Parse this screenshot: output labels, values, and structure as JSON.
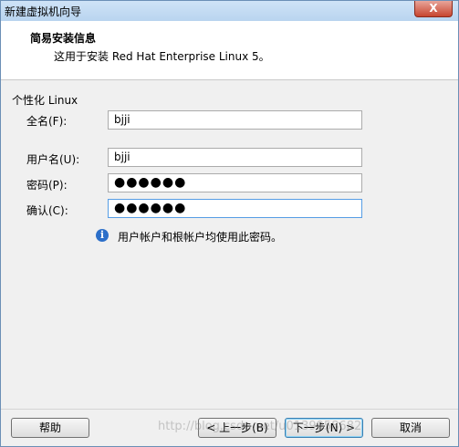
{
  "window": {
    "title": "新建虚拟机向导",
    "close_label": "X"
  },
  "header": {
    "title": "简易安装信息",
    "subtitle": "这用于安装 Red Hat Enterprise Linux 5。"
  },
  "form": {
    "group_label": "个性化 Linux",
    "fullname_label": "全名(F):",
    "fullname_value": "bjji",
    "username_label": "用户名(U):",
    "username_value": "bjji",
    "password_label": "密码(P):",
    "password_value": "●●●●●●",
    "confirm_label": "确认(C):",
    "confirm_value": "●●●●●●",
    "info_text": "用户帐户和根帐户均使用此密码。"
  },
  "footer": {
    "help_label": "帮助",
    "back_label": "< 上一步(B)",
    "next_label": "下一步(N) >",
    "cancel_label": "取消",
    "watermark": "http://blog.csdn.net/u0139958682"
  }
}
